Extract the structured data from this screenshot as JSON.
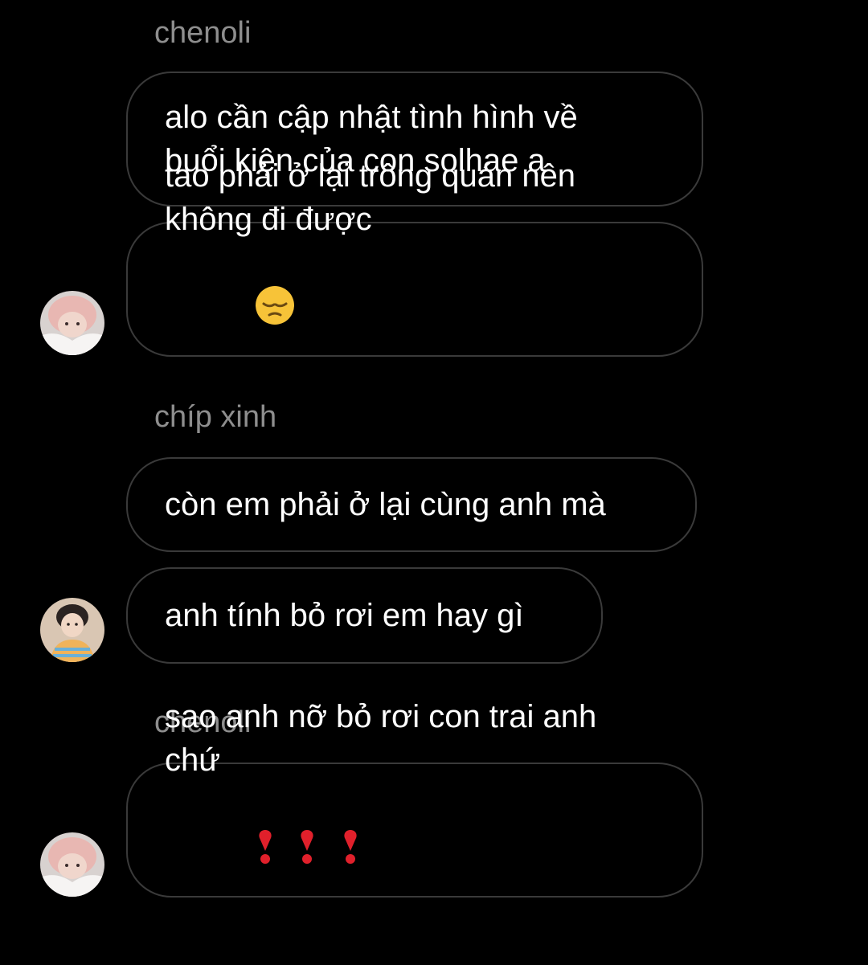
{
  "thread": {
    "groups": [
      {
        "sender": "chenoli",
        "messages": [
          {
            "line1": "alo cần cập nhật tình hình về",
            "line2": "buổi kiện của con solhae ạ"
          },
          {
            "line1": "tao phải ở lại trông quán nên",
            "line2": "không đi được",
            "emoji": "pensive-face-emoji"
          }
        ],
        "avatar": "chenoli-avatar"
      },
      {
        "sender": "chíp xinh",
        "messages": [
          {
            "line1": "còn em phải ở lại cùng anh mà"
          },
          {
            "line1": "anh tính bỏ rơi em hay gì"
          }
        ],
        "avatar": "chip-xinh-avatar"
      },
      {
        "sender": "chenoli",
        "messages": [
          {
            "line1": "sao anh nỡ bỏ rơi con trai anh",
            "line2": "chứ",
            "emoji": "heavy-exclamation-heart-emoji"
          }
        ],
        "avatar": "chenoli-avatar"
      }
    ]
  },
  "colors": {
    "background": "#000000",
    "bubble_border": "#3a3a3a",
    "sender_name": "#8e8e8e",
    "text": "#ffffff",
    "heart_red": "#e0202b"
  }
}
